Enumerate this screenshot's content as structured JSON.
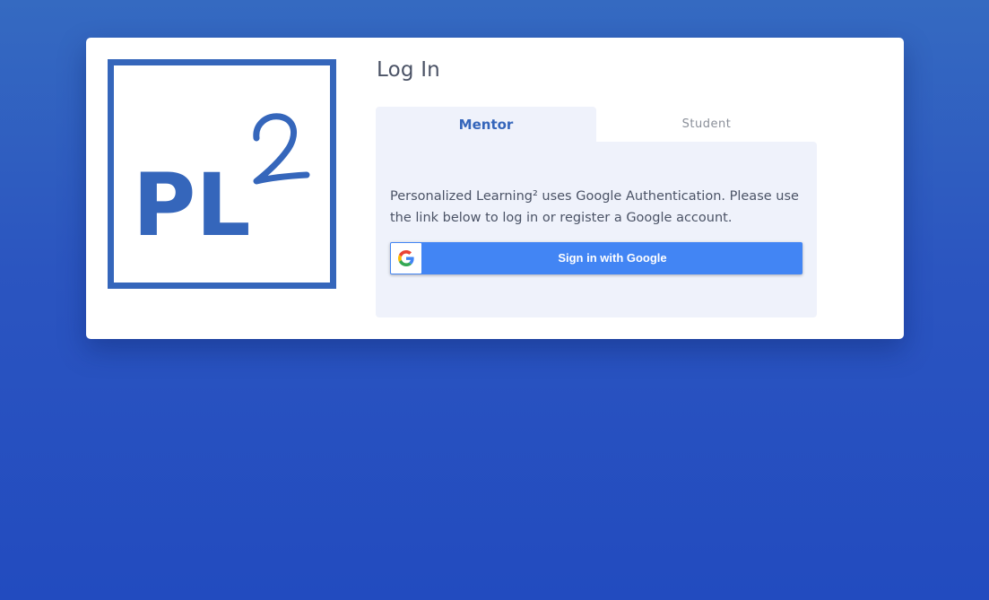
{
  "colors": {
    "brand": "#3566bb",
    "google_blue": "#4285f4",
    "panel_bg": "#eff2fb"
  },
  "logo": {
    "text": "PL",
    "superscript": "2"
  },
  "login": {
    "title": "Log In",
    "tabs": [
      {
        "label": "Mentor",
        "active": true
      },
      {
        "label": "Student",
        "active": false
      }
    ],
    "message": "Personalized Learning² uses Google Authentication. Please use the link below to log in or register a Google account.",
    "google_button": {
      "label": "Sign in with Google",
      "icon": "google-g-icon"
    }
  }
}
